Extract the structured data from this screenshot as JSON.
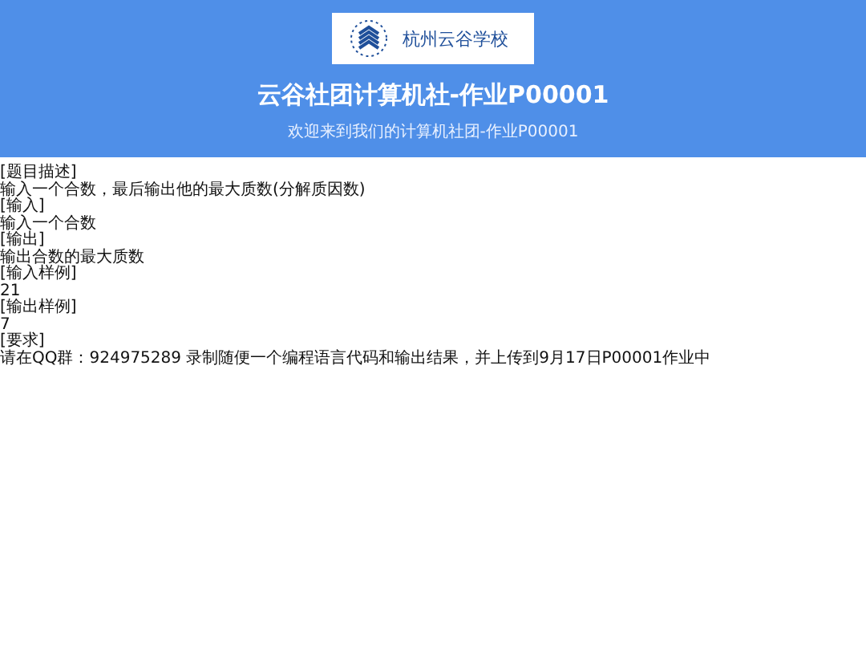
{
  "header": {
    "logo_text": "杭州云谷学校",
    "title": "云谷社团计算机社-作业P00001",
    "subtitle": "欢迎来到我们的计算机社团-作业P00001"
  },
  "content": [
    "[题目描述]",
    "输入一个合数，最后输出他的最大质数(分解质因数)",
    "[输入]",
    "输入一个合数",
    "[输出]",
    "输出合数的最大质数",
    "[输入样例]",
    "21",
    "[输出样例]",
    "7",
    "[要求]",
    "请在QQ群：924975289 录制随便一个编程语言代码和输出结果，并上传到9月17日P00001作业中"
  ]
}
